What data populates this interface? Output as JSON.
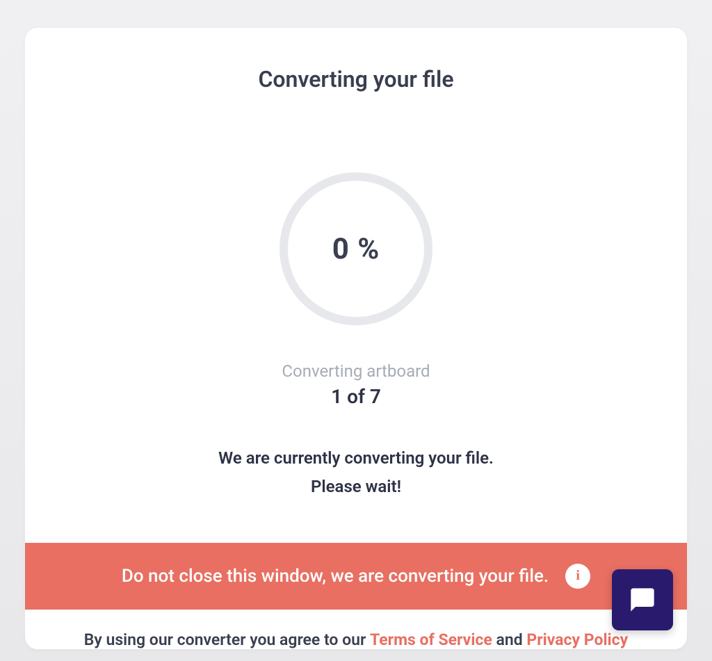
{
  "title": "Converting your file",
  "progress": {
    "percent_label": "0 %"
  },
  "artboard": {
    "label": "Converting artboard",
    "counter": "1 of 7"
  },
  "message": {
    "line1": "We are currently converting your file.",
    "line2": "Please wait!"
  },
  "warning": {
    "text": "Do not close this window, we are converting your file."
  },
  "footer": {
    "prefix": "By using our converter you agree to our ",
    "tos": "Terms of Service",
    "and": " and ",
    "privacy": "Privacy Policy"
  }
}
